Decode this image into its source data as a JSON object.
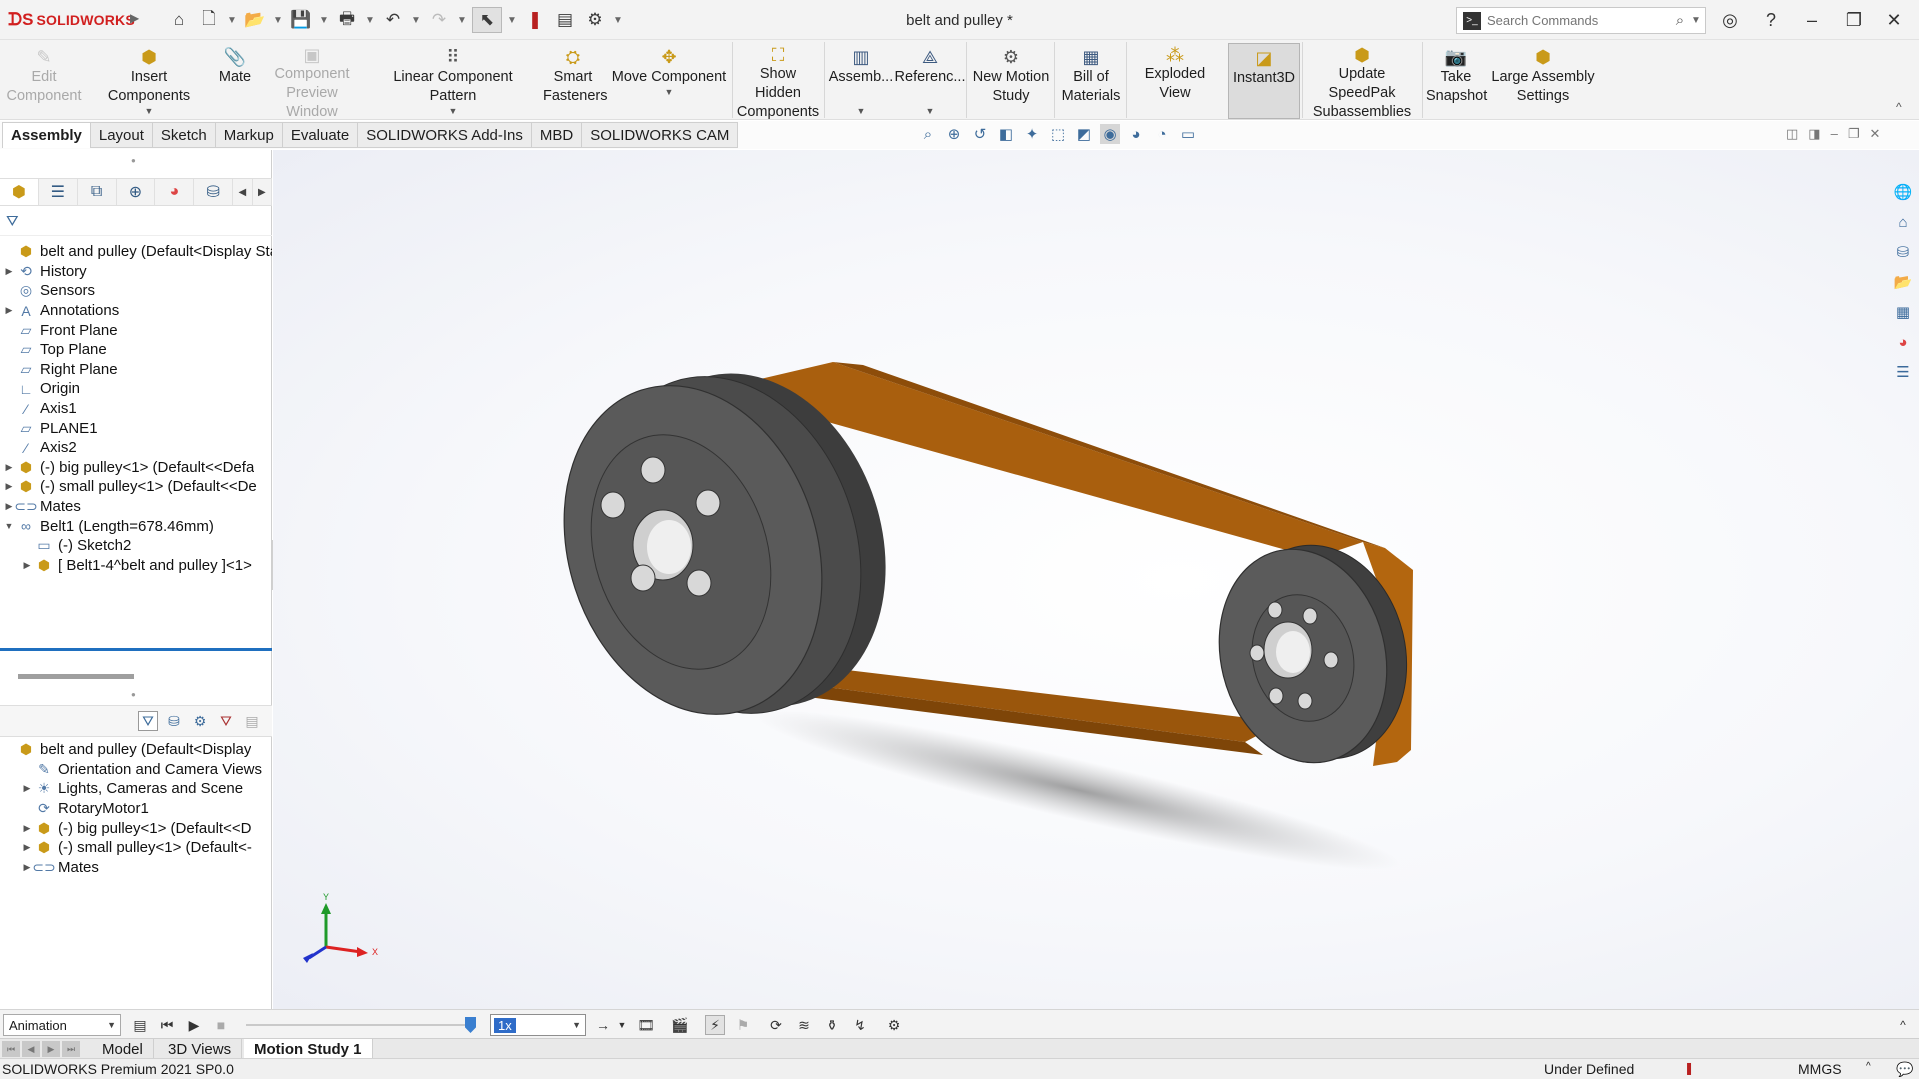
{
  "titlebar": {
    "app_logo": "SOLIDWORKS",
    "document_title": "belt and pulley *",
    "search_placeholder": "Search Commands",
    "quick_icons": [
      "home-icon",
      "new-document-icon",
      "open-icon",
      "save-icon",
      "print-icon",
      "undo-icon",
      "redo-icon",
      "select-icon",
      "rebuild-icon",
      "file-properties-icon",
      "options-icon"
    ]
  },
  "command_manager": {
    "buttons": [
      {
        "id": "edit-component",
        "label": "Edit Component",
        "enabled": false
      },
      {
        "id": "insert-components",
        "label": "Insert Components",
        "enabled": true,
        "has_menu": true
      },
      {
        "id": "mate",
        "label": "Mate",
        "enabled": true
      },
      {
        "id": "component-preview-window",
        "label": "Component Preview Window",
        "enabled": false
      },
      {
        "id": "linear-component-pattern",
        "label": "Linear Component Pattern",
        "enabled": true,
        "has_menu": true
      },
      {
        "id": "smart-fasteners",
        "label": "Smart Fasteners",
        "enabled": true
      },
      {
        "id": "move-component",
        "label": "Move Component",
        "enabled": true,
        "has_menu": true
      },
      {
        "id": "show-hidden-components",
        "label": "Show Hidden Components",
        "enabled": true
      },
      {
        "id": "assembly-features",
        "label": "Assemb...",
        "enabled": true,
        "has_menu": true
      },
      {
        "id": "reference-geometry",
        "label": "Referenc...",
        "enabled": true,
        "has_menu": true
      },
      {
        "id": "new-motion-study",
        "label": "New Motion Study",
        "enabled": true
      },
      {
        "id": "bill-of-materials",
        "label": "Bill of Materials",
        "enabled": true
      },
      {
        "id": "exploded-view",
        "label": "Exploded View",
        "enabled": true,
        "has_menu": true
      },
      {
        "id": "instant3d",
        "label": "Instant3D",
        "enabled": true,
        "active": true
      },
      {
        "id": "update-speedpak",
        "label": "Update SpeedPak Subassemblies",
        "enabled": true
      },
      {
        "id": "take-snapshot",
        "label": "Take Snapshot",
        "enabled": true
      },
      {
        "id": "large-assembly-settings",
        "label": "Large Assembly Settings",
        "enabled": true
      }
    ]
  },
  "tabs": [
    "Assembly",
    "Layout",
    "Sketch",
    "Markup",
    "Evaluate",
    "SOLIDWORKS Add-Ins",
    "MBD",
    "SOLIDWORKS CAM"
  ],
  "active_tab": "Assembly",
  "feature_tree": {
    "root": "belt and pulley  (Default<Display Sta",
    "items": [
      {
        "label": "History",
        "icon": "history-icon",
        "expandable": true
      },
      {
        "label": "Sensors",
        "icon": "sensors-icon",
        "expandable": false
      },
      {
        "label": "Annotations",
        "icon": "annotations-icon",
        "expandable": true
      },
      {
        "label": "Front Plane",
        "icon": "plane-icon",
        "expandable": false
      },
      {
        "label": "Top Plane",
        "icon": "plane-icon",
        "expandable": false
      },
      {
        "label": "Right Plane",
        "icon": "plane-icon",
        "expandable": false
      },
      {
        "label": "Origin",
        "icon": "origin-icon",
        "expandable": false
      },
      {
        "label": "Axis1",
        "icon": "axis-icon",
        "expandable": false
      },
      {
        "label": "PLANE1",
        "icon": "plane-icon",
        "expandable": false
      },
      {
        "label": "Axis2",
        "icon": "axis-icon",
        "expandable": false
      },
      {
        "label": "(-) big pulley<1> (Default<<Defa",
        "icon": "part-icon",
        "expandable": true
      },
      {
        "label": "(-) small pulley<1> (Default<<De",
        "icon": "part-icon",
        "expandable": true
      },
      {
        "label": "Mates",
        "icon": "mates-icon",
        "expandable": true
      },
      {
        "label": "Belt1 (Length=678.46mm)",
        "icon": "belt-icon",
        "expandable": true,
        "expanded": true
      },
      {
        "label": "(-) Sketch2",
        "icon": "sketch-icon",
        "expandable": false,
        "indent": 1
      },
      {
        "label": "[ Belt1-4^belt and pulley ]<1>",
        "icon": "part-icon",
        "expandable": true,
        "indent": 1
      }
    ]
  },
  "motion_tree": {
    "root": "belt and pulley  (Default<Display",
    "items": [
      {
        "label": "Orientation and Camera Views",
        "icon": "camera-icon",
        "expandable": false
      },
      {
        "label": "Lights, Cameras and Scene",
        "icon": "lights-icon",
        "expandable": true
      },
      {
        "label": "RotaryMotor1",
        "icon": "motor-icon",
        "expandable": false
      },
      {
        "label": "(-) big pulley<1> (Default<<D",
        "icon": "part-icon",
        "expandable": true
      },
      {
        "label": "(-) small pulley<1> (Default<-",
        "icon": "part-icon",
        "expandable": true
      },
      {
        "label": "Mates",
        "icon": "mates-icon",
        "expandable": true
      }
    ]
  },
  "triad": {
    "x": "X",
    "y": "Y"
  },
  "motion_manager": {
    "study_type": "Animation",
    "playback_speed": "1x"
  },
  "bottom_tabs": [
    "Model",
    "3D Views",
    "Motion Study 1"
  ],
  "active_bottom_tab": "Motion Study 1",
  "status": {
    "product": "SOLIDWORKS Premium 2021 SP0.0",
    "state": "Under Defined",
    "units": "MMGS"
  },
  "colors": {
    "belt": "#b5680f",
    "pulley": "#555555",
    "brand_red": "#d11f1f",
    "selection_blue": "#1f6fbf"
  }
}
